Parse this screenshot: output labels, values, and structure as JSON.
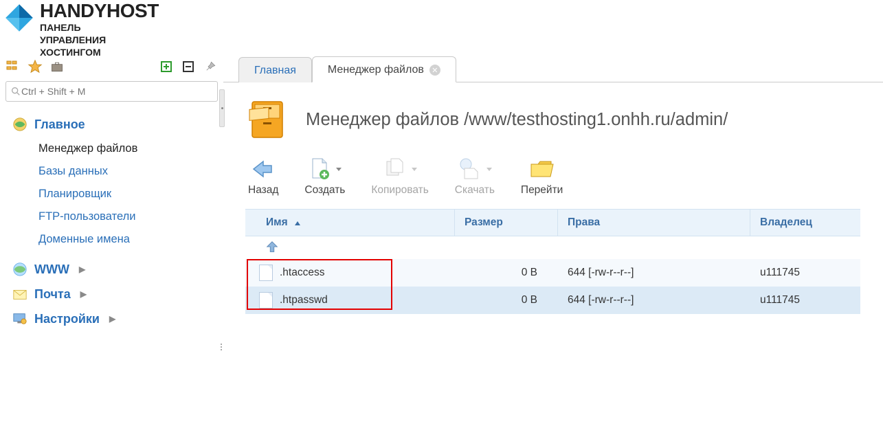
{
  "logo": {
    "brand": "HANDYHOST",
    "sub1": "ПАНЕЛЬ",
    "sub2": "УПРАВЛЕНИЯ",
    "sub3": "ХОСТИНГОМ"
  },
  "search": {
    "placeholder": "Ctrl + Shift + M"
  },
  "sidebar": {
    "groups": [
      {
        "label": "Главное",
        "expanded": true,
        "items": [
          {
            "label": "Менеджер файлов",
            "active": true
          },
          {
            "label": "Базы данных"
          },
          {
            "label": "Планировщик"
          },
          {
            "label": "FTP-пользователи"
          },
          {
            "label": "Доменные имена"
          }
        ]
      },
      {
        "label": "WWW",
        "expanded": false
      },
      {
        "label": "Почта",
        "expanded": false
      },
      {
        "label": "Настройки",
        "expanded": false
      }
    ]
  },
  "tabs": [
    {
      "label": "Главная",
      "active": false,
      "closable": false
    },
    {
      "label": "Менеджер файлов",
      "active": true,
      "closable": true
    }
  ],
  "page": {
    "title": "Менеджер файлов /www/testhosting1.onhh.ru/admin/"
  },
  "actions": {
    "back": "Назад",
    "create": "Создать",
    "copy": "Копировать",
    "download": "Скачать",
    "go": "Перейти"
  },
  "table": {
    "headers": {
      "name": "Имя",
      "size": "Размер",
      "perm": "Права",
      "owner": "Владелец"
    },
    "rows": [
      {
        "name": ".htaccess",
        "size": "0 B",
        "perm": "644 [-rw-r--r--]",
        "owner": "u111745"
      },
      {
        "name": ".htpasswd",
        "size": "0 B",
        "perm": "644 [-rw-r--r--]",
        "owner": "u111745"
      }
    ]
  }
}
